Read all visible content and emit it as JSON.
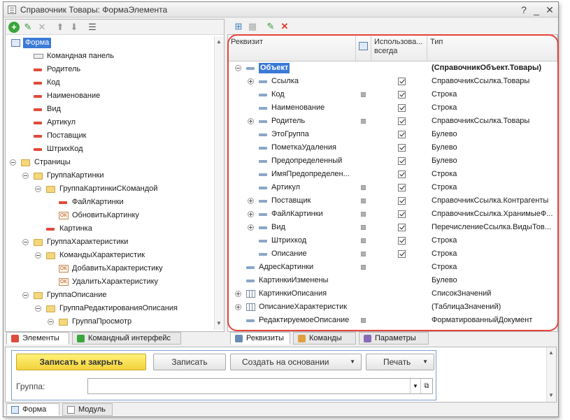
{
  "window": {
    "title": "Справочник Товары: ФормаЭлемента",
    "help": "?",
    "min": "_",
    "max": "□",
    "close": "✕"
  },
  "left_tree": [
    {
      "label": "Форма",
      "icon": "form-icon",
      "selected": true
    },
    {
      "label": "Командная панель",
      "icon": "command-panel-icon"
    },
    {
      "label": "Родитель",
      "icon": "field-icon"
    },
    {
      "label": "Код",
      "icon": "field-icon"
    },
    {
      "label": "Наименование",
      "icon": "field-icon"
    },
    {
      "label": "Вид",
      "icon": "field-icon"
    },
    {
      "label": "Артикул",
      "icon": "field-icon"
    },
    {
      "label": "Поставщик",
      "icon": "field-icon"
    },
    {
      "label": "ШтрихКод",
      "icon": "field-icon"
    },
    {
      "label": "Страницы",
      "icon": "folder-icon"
    },
    {
      "label": "ГруппаКартинки",
      "icon": "folder-icon"
    },
    {
      "label": "ГруппаКартинкиСКомандой",
      "icon": "folder-icon"
    },
    {
      "label": "ФайлКартинки",
      "icon": "field-icon"
    },
    {
      "label": "ОбновитьКартинку",
      "icon": "ok-button-icon"
    },
    {
      "label": "Картинка",
      "icon": "field-icon"
    },
    {
      "label": "ГруппаХарактеристики",
      "icon": "folder-icon"
    },
    {
      "label": "КомандыХарактеристик",
      "icon": "folder-icon"
    },
    {
      "label": "ДобавитьХарактеристику",
      "icon": "ok-button-icon"
    },
    {
      "label": "УдалитьХарактеристику",
      "icon": "ok-button-icon"
    },
    {
      "label": "ГруппаОписание",
      "icon": "folder-icon"
    },
    {
      "label": "ГруппаРедактированияОписания",
      "icon": "folder-icon"
    },
    {
      "label": "ГруппаПросмотр",
      "icon": "folder-icon"
    }
  ],
  "left_tabs": [
    "Элементы",
    "Командный интерфейс"
  ],
  "grid": {
    "col_attr": "Реквизит",
    "col_used": "Использова... всегда",
    "col_type": "Тип",
    "rows": [
      {
        "name": "Объект",
        "type": "(СправочникОбъект.Товары)",
        "bold": true
      },
      {
        "name": "Ссылка",
        "type": "СправочникСсылка.Товары"
      },
      {
        "name": "Код",
        "type": "Строка"
      },
      {
        "name": "Наименование",
        "type": "Строка"
      },
      {
        "name": "Родитель",
        "type": "СправочникСсылка.Товары"
      },
      {
        "name": "ЭтоГруппа",
        "type": "Булево"
      },
      {
        "name": "ПометкаУдаления",
        "type": "Булево"
      },
      {
        "name": "Предопределенный",
        "type": "Булево"
      },
      {
        "name": "ИмяПредопределен...",
        "type": "Строка"
      },
      {
        "name": "Артикул",
        "type": "Строка"
      },
      {
        "name": "Поставщик",
        "type": "СправочникСсылка.Контрагенты"
      },
      {
        "name": "ФайлКартинки",
        "type": "СправочникСсылка.ХранимыеФ..."
      },
      {
        "name": "Вид",
        "type": "ПеречислениеСсылка.ВидыТов..."
      },
      {
        "name": "Штрихкод",
        "type": "Строка"
      },
      {
        "name": "Описание",
        "type": "Строка"
      },
      {
        "name": "АдресКартинки",
        "type": "Строка"
      },
      {
        "name": "КартинкиИзменены",
        "type": "Булево"
      },
      {
        "name": "КартинкиОписания",
        "type": "СписокЗначений"
      },
      {
        "name": "ОписаниеХарактеристик",
        "type": "(ТаблицаЗначений)"
      },
      {
        "name": "РедактируемоеОписание",
        "type": "ФорматированныйДокумент"
      }
    ]
  },
  "right_tabs": [
    "Реквизиты",
    "Команды",
    "Параметры"
  ],
  "preview": {
    "btn_save_close": "Записать и закрыть",
    "btn_save": "Записать",
    "btn_create_based": "Создать на основании",
    "btn_print": "Печать",
    "group_label": "Группа:",
    "group_value": ""
  },
  "bottom_tabs": [
    "Форма",
    "Модуль"
  ],
  "colors": {
    "highlight_border": "#e8423a",
    "primary_button": "#f2d23a"
  }
}
